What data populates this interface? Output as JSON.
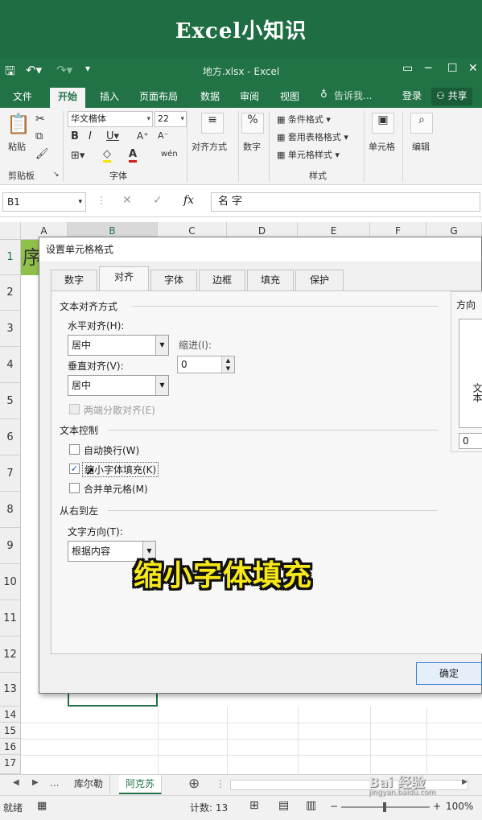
{
  "banner": {
    "title": "Excel小知识"
  },
  "titlebar": {
    "doc_title": "地方.xlsx - Excel",
    "minimize": "─",
    "restore": "☐",
    "close": "✕",
    "restore_ribbon": "▭"
  },
  "tabs": {
    "items": [
      "文件",
      "开始",
      "插入",
      "页面布局",
      "数据",
      "审阅",
      "视图"
    ],
    "tell_me": "告诉我...",
    "login": "登录",
    "share": "共享"
  },
  "ribbon": {
    "clipboard": {
      "paste": "粘贴",
      "group": "剪贴板"
    },
    "font": {
      "name": "华文楷体",
      "size": "22",
      "group": "字体"
    },
    "alignment": {
      "label": "对齐方式"
    },
    "number": {
      "label": "数字"
    },
    "styles": {
      "conditional": "条件格式",
      "table": "套用表格格式",
      "cell_style": "单元格样式",
      "group": "样式"
    },
    "cells": {
      "label": "单元格"
    },
    "editing": {
      "label": "编辑"
    }
  },
  "formula": {
    "cell_ref": "B1",
    "fx": "fx",
    "value": "名字"
  },
  "grid": {
    "columns": [
      "A",
      "B",
      "C",
      "D",
      "E",
      "F",
      "G"
    ],
    "rows": [
      "1",
      "2",
      "3",
      "4",
      "5",
      "6",
      "7",
      "8",
      "9",
      "10",
      "11",
      "12",
      "13",
      "14",
      "15",
      "16",
      "17"
    ],
    "a1_fragment": "序"
  },
  "dialog": {
    "title": "设置单元格格式",
    "tabs": [
      "数字",
      "对齐",
      "字体",
      "边框",
      "填充",
      "保护"
    ],
    "text_alignment": "文本对齐方式",
    "horizontal_label": "水平对齐(H):",
    "horizontal_value": "居中",
    "indent_label": "缩进(I):",
    "indent_value": "0",
    "vertical_label": "垂直对齐(V):",
    "vertical_value": "居中",
    "distributed": "两端分散对齐(E)",
    "text_control": "文本控制",
    "wrap": "自动换行(W)",
    "shrink": "缩小字体填充(K)",
    "merge": "合并单元格(M)",
    "rtl": "从右到左",
    "direction_label": "文字方向(T):",
    "direction_value": "根据内容",
    "orientation": "方向",
    "orientation_text": "文本",
    "degree_value": "0",
    "ok": "确定"
  },
  "caption": "缩小字体填充",
  "sheets": {
    "ellipsis": "...",
    "tab1": "库尔勒",
    "tab2": "阿克苏",
    "add": "⊕"
  },
  "status": {
    "ready": "就绪",
    "count": "计数: 13",
    "zoom": "100%"
  },
  "watermark": {
    "brand": "Bai 经验",
    "url": "jingyan.baidu.com"
  }
}
